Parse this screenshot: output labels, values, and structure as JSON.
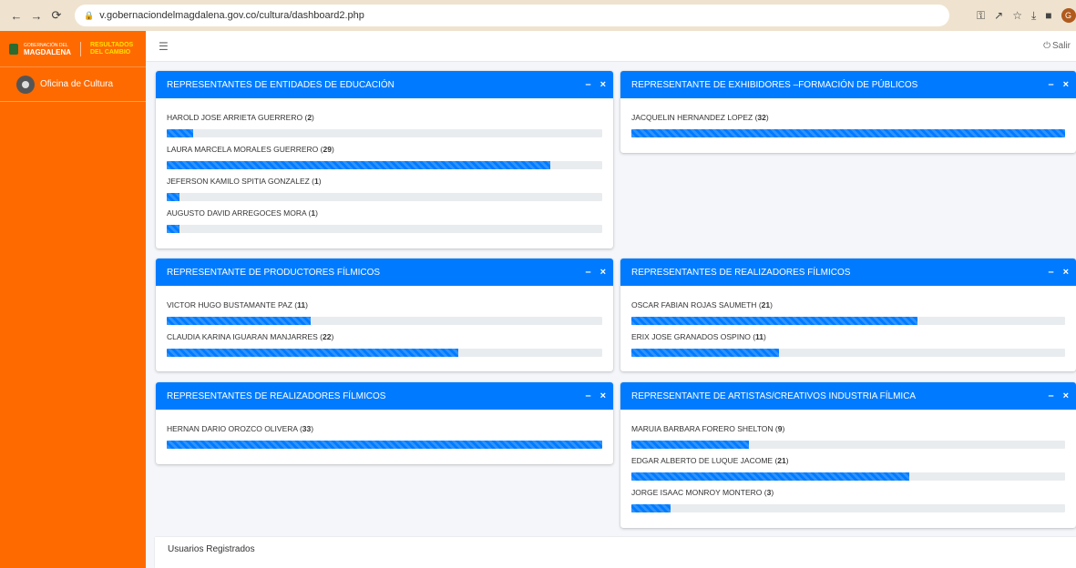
{
  "browser": {
    "url": "v.gobernaciondelmagdalena.gov.co/cultura/dashboard2.php",
    "profile_initial": "G"
  },
  "sidebar": {
    "brand_main": "MAGDALENA",
    "brand_small": "GOBERNACIÓN DEL",
    "brand_logo2_top": "RESULTADOS",
    "brand_logo2_bottom": "DEL CAMBIO",
    "user_name": "Oficina de Cultura"
  },
  "topbar": {
    "logout_label": "Salir"
  },
  "cards": [
    {
      "title": "REPRESENTANTES DE ENTIDADES DE EDUCACIÓN",
      "reps": [
        {
          "name": "HAROLD JOSE ARRIETA GUERRERO",
          "count": "2",
          "pct": 6
        },
        {
          "name": "LAURA MARCELA MORALES GUERRERO",
          "count": "29",
          "pct": 88
        },
        {
          "name": "JEFERSON KAMILO SPITIA GONZALEZ",
          "count": "1",
          "pct": 3
        },
        {
          "name": "AUGUSTO DAVID ARREGOCES MORA",
          "count": "1",
          "pct": 3
        }
      ]
    },
    {
      "title": "REPRESENTANTE DE EXHIBIDORES –FORMACIÓN DE PÚBLICOS",
      "reps": [
        {
          "name": "JACQUELIN HERNANDEZ LOPEZ",
          "count": "32",
          "pct": 100
        }
      ]
    },
    {
      "title": "REPRESENTANTE DE PRODUCTORES FÍLMICOS",
      "reps": [
        {
          "name": "VICTOR HUGO BUSTAMANTE PAZ",
          "count": "11",
          "pct": 33
        },
        {
          "name": "CLAUDIA KARINA IGUARAN MANJARRES",
          "count": "22",
          "pct": 67
        }
      ]
    },
    {
      "title": "REPRESENTANTES DE REALIZADORES FÍLMICOS",
      "reps": [
        {
          "name": "OSCAR FABIAN ROJAS SAUMETH",
          "count": "21",
          "pct": 66
        },
        {
          "name": "ERIX JOSE GRANADOS OSPINO",
          "count": "11",
          "pct": 34
        }
      ]
    },
    {
      "title": "REPRESENTANTES DE REALIZADORES FÍLMICOS",
      "reps": [
        {
          "name": "HERNAN DARIO OROZCO OLIVERA",
          "count": "33",
          "pct": 100
        }
      ]
    },
    {
      "title": "REPRESENTANTE DE ARTISTAS/CREATIVOS INDUSTRIA FÍLMICA",
      "reps": [
        {
          "name": "MARUIA BARBARA FORERO SHELTON",
          "count": "9",
          "pct": 27
        },
        {
          "name": "EDGAR ALBERTO DE LUQUE JACOME",
          "count": "21",
          "pct": 64
        },
        {
          "name": "JORGE ISAAC MONROY MONTERO",
          "count": "3",
          "pct": 9
        }
      ]
    }
  ],
  "footer_card_title": "Usuarios Registrados",
  "colors": {
    "sidebar": "#ff6a00",
    "card_header": "#007bff",
    "bar_fill": "#007bff"
  }
}
